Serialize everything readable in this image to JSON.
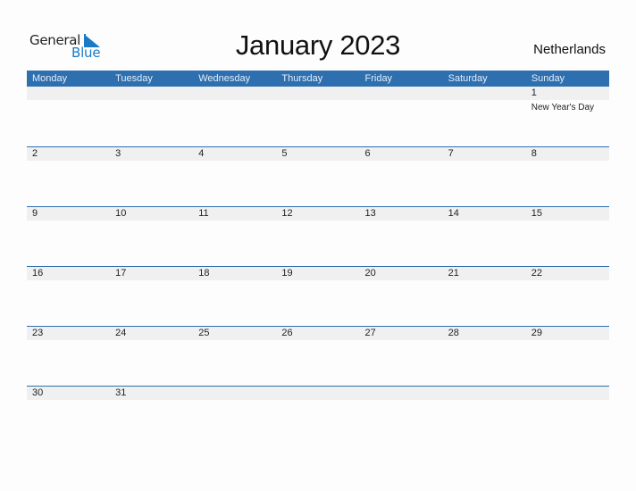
{
  "logo": {
    "word1": "General",
    "word2": "Blue",
    "accent_color": "#1a7ac8"
  },
  "title": "January 2023",
  "country": "Netherlands",
  "colors": {
    "header_bg": "#2e6fb0",
    "row_strip": "#f0f0f0"
  },
  "weekdays": [
    "Monday",
    "Tuesday",
    "Wednesday",
    "Thursday",
    "Friday",
    "Saturday",
    "Sunday"
  ],
  "weeks": [
    [
      {
        "day": ""
      },
      {
        "day": ""
      },
      {
        "day": ""
      },
      {
        "day": ""
      },
      {
        "day": ""
      },
      {
        "day": ""
      },
      {
        "day": "1",
        "holiday": "New Year's Day"
      }
    ],
    [
      {
        "day": "2"
      },
      {
        "day": "3"
      },
      {
        "day": "4"
      },
      {
        "day": "5"
      },
      {
        "day": "6"
      },
      {
        "day": "7"
      },
      {
        "day": "8"
      }
    ],
    [
      {
        "day": "9"
      },
      {
        "day": "10"
      },
      {
        "day": "11"
      },
      {
        "day": "12"
      },
      {
        "day": "13"
      },
      {
        "day": "14"
      },
      {
        "day": "15"
      }
    ],
    [
      {
        "day": "16"
      },
      {
        "day": "17"
      },
      {
        "day": "18"
      },
      {
        "day": "19"
      },
      {
        "day": "20"
      },
      {
        "day": "21"
      },
      {
        "day": "22"
      }
    ],
    [
      {
        "day": "23"
      },
      {
        "day": "24"
      },
      {
        "day": "25"
      },
      {
        "day": "26"
      },
      {
        "day": "27"
      },
      {
        "day": "28"
      },
      {
        "day": "29"
      }
    ],
    [
      {
        "day": "30"
      },
      {
        "day": "31"
      },
      {
        "day": ""
      },
      {
        "day": ""
      },
      {
        "day": ""
      },
      {
        "day": ""
      },
      {
        "day": ""
      }
    ]
  ]
}
